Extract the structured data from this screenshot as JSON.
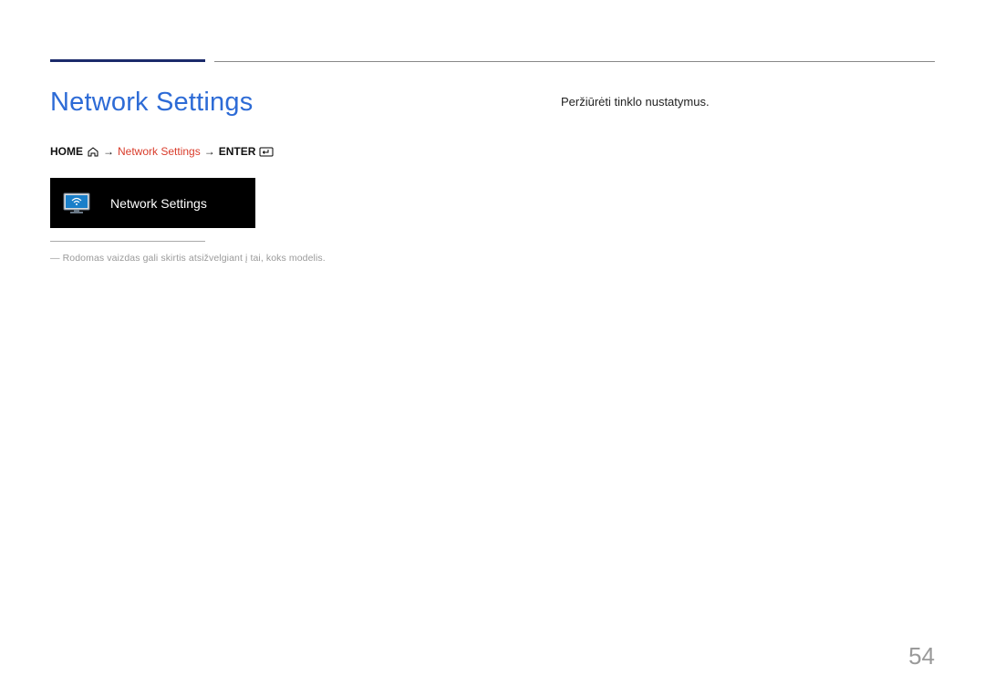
{
  "page_title": "Network Settings",
  "breadcrumb": {
    "home": "HOME",
    "arrow": "→",
    "current": "Network Settings",
    "enter": "ENTER"
  },
  "tile": {
    "label": "Network Settings"
  },
  "footnote": "―  Rodomas vaizdas gali skirtis atsižvelgiant į tai, koks modelis.",
  "description": "Peržiūrėti tinklo nustatymus.",
  "page_number": "54"
}
